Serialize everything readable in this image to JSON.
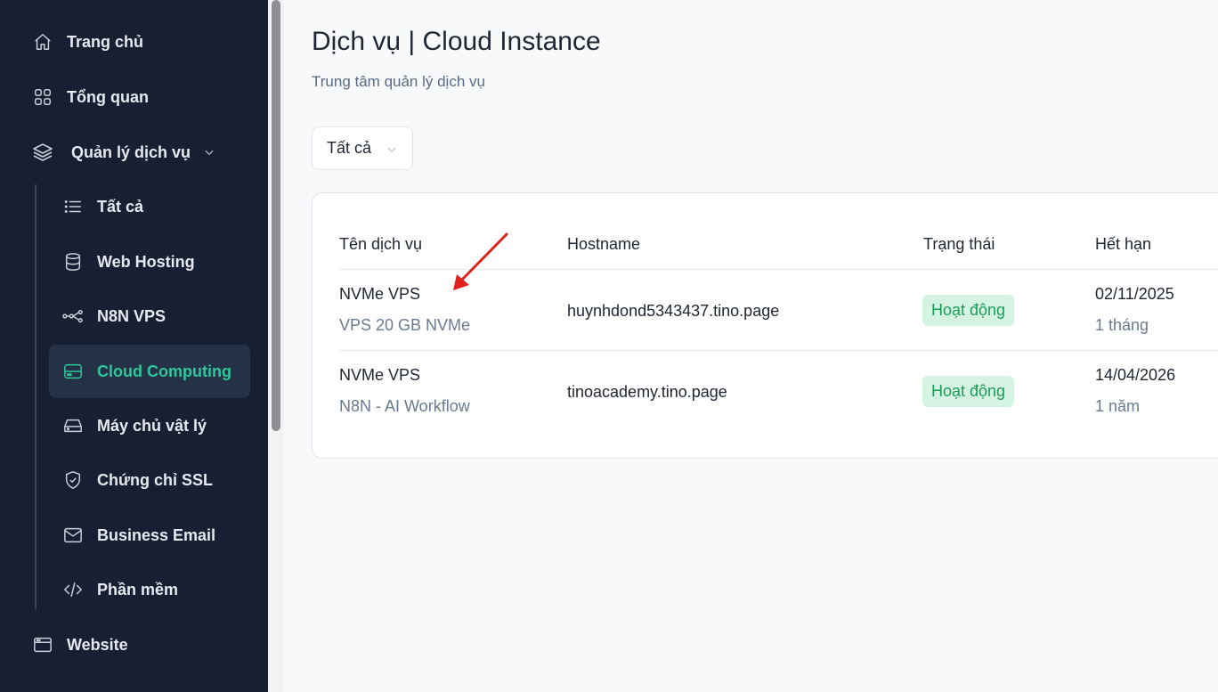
{
  "sidebar": {
    "items": [
      {
        "label": "Trang chủ",
        "icon": "home-icon"
      },
      {
        "label": "Tổng quan",
        "icon": "grid-icon"
      },
      {
        "label": "Quản lý dịch vụ",
        "icon": "layers-icon"
      },
      {
        "label": "Website",
        "icon": "browser-icon"
      }
    ],
    "sub_items": [
      {
        "label": "Tất cả",
        "icon": "list-icon"
      },
      {
        "label": "Web Hosting",
        "icon": "database-icon"
      },
      {
        "label": "N8N VPS",
        "icon": "workflow-icon"
      },
      {
        "label": "Cloud Computing",
        "icon": "server-icon",
        "active": true
      },
      {
        "label": "Máy chủ vật lý",
        "icon": "hard-drive-icon"
      },
      {
        "label": "Chứng chỉ SSL",
        "icon": "shield-check-icon"
      },
      {
        "label": "Business Email",
        "icon": "mail-icon"
      },
      {
        "label": "Phần mềm",
        "icon": "code-icon"
      }
    ]
  },
  "page": {
    "title": "Dịch vụ | Cloud Instance",
    "subtitle": "Trung tâm quản lý dịch vụ"
  },
  "filter": {
    "selected": "Tất cả"
  },
  "table": {
    "headers": [
      "Tên dịch vụ",
      "Hostname",
      "Trạng thái",
      "Hết hạn"
    ],
    "rows": [
      {
        "name": "NVMe VPS",
        "plan": "VPS 20 GB NVMe",
        "hostname": "huynhdond5343437.tino.page",
        "status": "Hoạt động",
        "expiry": "02/11/2025",
        "cycle": "1 tháng"
      },
      {
        "name": "NVMe VPS",
        "plan": "N8N - AI Workflow",
        "hostname": "tinoacademy.tino.page",
        "status": "Hoạt động",
        "expiry": "14/04/2026",
        "cycle": "1 năm"
      }
    ]
  },
  "colors": {
    "sidebar_bg": "#172033",
    "accent": "#2ec89a",
    "status_bg": "#d4f3e3",
    "status_text": "#1e9b57",
    "annotation_arrow": "#e0201b"
  }
}
